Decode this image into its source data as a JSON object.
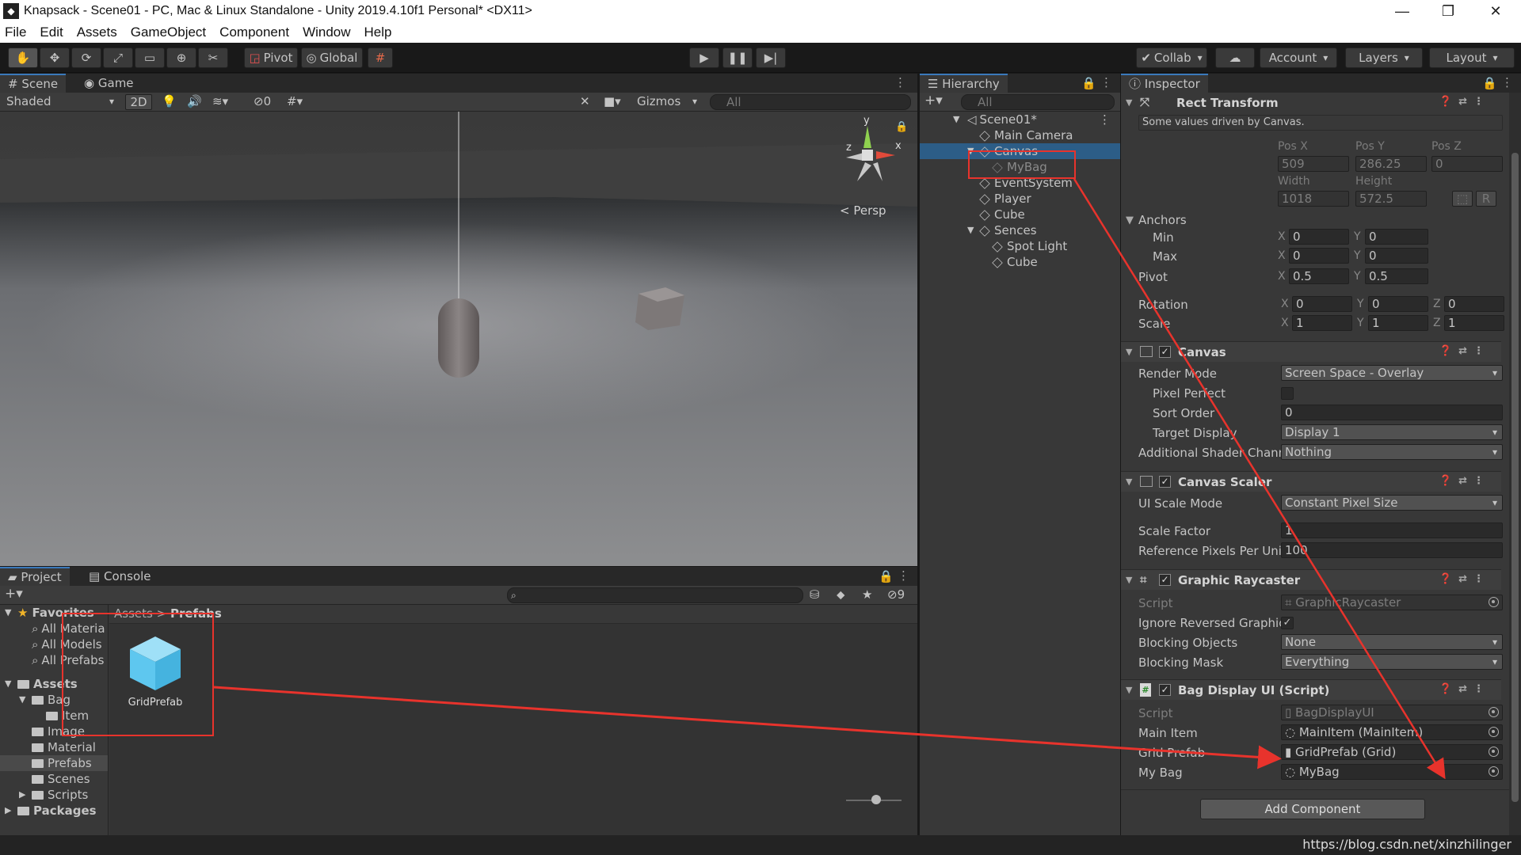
{
  "window": {
    "title": "Knapsack - Scene01 - PC, Mac & Linux Standalone - Unity 2019.4.10f1 Personal* <DX11>",
    "logo_icon": "unity-logo-icon",
    "minimize": "—",
    "maximize": "❐",
    "close": "✕"
  },
  "menu": [
    "File",
    "Edit",
    "Assets",
    "GameObject",
    "Component",
    "Window",
    "Help"
  ],
  "toolbar": {
    "pivot": "Pivot",
    "global": "Global",
    "collab": "Collab",
    "account": "Account",
    "layers": "Layers",
    "layout": "Layout"
  },
  "scene": {
    "tab_scene": "Scene",
    "tab_game": "Game",
    "shading": "Shaded",
    "mode_2d": "2D",
    "hidden_count": "0",
    "gizmos": "Gizmos",
    "search_placeholder": "All",
    "persp": "< Persp",
    "gizmo_y": "y",
    "gizmo_x": "x",
    "gizmo_z": "z"
  },
  "hierarchy": {
    "tab": "Hierarchy",
    "search_placeholder": "All",
    "scene": "Scene01*",
    "items": [
      {
        "label": "Main Camera"
      },
      {
        "label": "Canvas"
      },
      {
        "label": "MyBag"
      },
      {
        "label": "EventSystem"
      },
      {
        "label": "Player"
      },
      {
        "label": "Cube"
      },
      {
        "label": "Sences"
      },
      {
        "label": "Spot Light"
      },
      {
        "label": "Cube"
      }
    ]
  },
  "inspector": {
    "tab": "Inspector",
    "rect_transform": {
      "title": "Rect Transform",
      "notice": "Some values driven by Canvas.",
      "pos_x_label": "Pos X",
      "pos_y_label": "Pos Y",
      "pos_z_label": "Pos Z",
      "pos_x": "509",
      "pos_y": "286.25",
      "pos_z": "0",
      "width_label": "Width",
      "height_label": "Height",
      "width": "1018",
      "height": "572.5",
      "r_button": "R",
      "anchors": "Anchors",
      "min": "Min",
      "max": "Max",
      "min_x": "0",
      "min_y": "0",
      "max_x": "0",
      "max_y": "0",
      "pivot": "Pivot",
      "pivot_x": "0.5",
      "pivot_y": "0.5",
      "rotation": "Rotation",
      "rot_x": "0",
      "rot_y": "0",
      "rot_z": "0",
      "scale": "Scale",
      "scale_x": "1",
      "scale_y": "1",
      "scale_z": "1",
      "axis_x": "X",
      "axis_y": "Y",
      "axis_z": "Z"
    },
    "canvas": {
      "title": "Canvas",
      "render_mode_label": "Render Mode",
      "render_mode": "Screen Space - Overlay",
      "pixel_perfect_label": "Pixel Perfect",
      "sort_order_label": "Sort Order",
      "sort_order": "0",
      "target_display_label": "Target Display",
      "target_display": "Display 1",
      "shader_channels_label": "Additional Shader Chann",
      "shader_channels": "Nothing"
    },
    "canvas_scaler": {
      "title": "Canvas Scaler",
      "ui_scale_mode_label": "UI Scale Mode",
      "ui_scale_mode": "Constant Pixel Size",
      "scale_factor_label": "Scale Factor",
      "scale_factor": "1",
      "ref_ppu_label": "Reference Pixels Per Uni",
      "ref_ppu": "100"
    },
    "graphic_raycaster": {
      "title": "Graphic Raycaster",
      "script_label": "Script",
      "script": "GraphicRaycaster",
      "ignore_reversed_label": "Ignore Reversed Graphic",
      "blocking_objects_label": "Blocking Objects",
      "blocking_objects": "None",
      "blocking_mask_label": "Blocking Mask",
      "blocking_mask": "Everything"
    },
    "bag_display": {
      "title": "Bag Display UI (Script)",
      "script_label": "Script",
      "script": "BagDisplayUI",
      "main_item_label": "Main Item",
      "main_item": "MainItem (MainItem)",
      "grid_prefab_label": "Grid Prefab",
      "grid_prefab": "GridPrefab (Grid)",
      "my_bag_label": "My Bag",
      "my_bag": "MyBag"
    },
    "add_component": "Add Component"
  },
  "project": {
    "tab_project": "Project",
    "tab_console": "Console",
    "hidden_count": "9",
    "favorites": "Favorites",
    "fav_items": [
      "All Materia",
      "All Models",
      "All Prefabs"
    ],
    "assets": "Assets",
    "folders": [
      "Bag",
      "Item",
      "Image",
      "Material",
      "Prefabs",
      "Scenes",
      "Scripts"
    ],
    "packages": "Packages",
    "breadcrumb_root": "Assets",
    "breadcrumb_sep": ">",
    "breadcrumb_leaf": "Prefabs",
    "asset_name": "GridPrefab"
  },
  "watermark": "https://blog.csdn.net/xinzhilinger",
  "colors": {
    "accent": "#3a79bb",
    "selection": "#2c5d87",
    "annotation_red": "#e8332c",
    "prefab_blue": "#5ec7ef"
  }
}
